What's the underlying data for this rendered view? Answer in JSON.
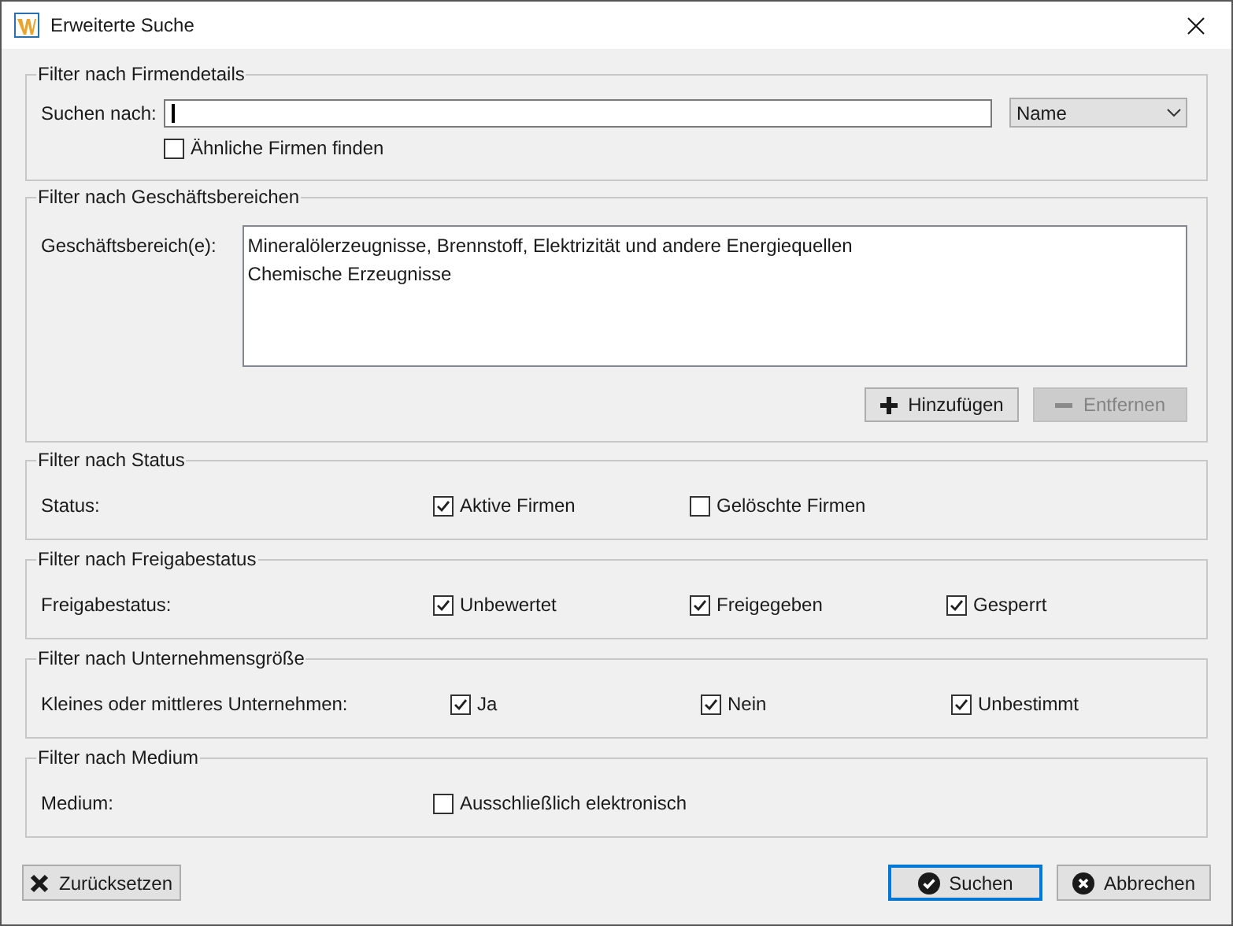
{
  "window": {
    "title": "Erweiterte Suche"
  },
  "company_details": {
    "legend": "Filter nach Firmendetails",
    "search_label": "Suchen nach:",
    "search_focused": true,
    "search_by": "Name",
    "similar": {
      "label": "Ähnliche Firmen finden",
      "checked": false
    }
  },
  "business_areas": {
    "legend": "Filter nach Geschäftsbereichen",
    "label": "Geschäftsbereich(e):",
    "items": [
      {
        "label": "Mineralölerzeugnisse, Brennstoff, Elektrizität und andere Energiequellen"
      },
      {
        "label": "Chemische Erzeugnisse"
      }
    ],
    "buttons": [
      {
        "label": "Hinzufügen",
        "kind": "plus",
        "disabled": false
      },
      {
        "label": "Entfernen",
        "kind": "minus",
        "disabled": true
      }
    ]
  },
  "filter_groups": [
    {
      "legend": "Filter nach Status",
      "label": "Status:",
      "options": [
        {
          "label": "Aktive Firmen",
          "checked": true
        },
        {
          "label": "Gelöschte Firmen",
          "checked": false
        }
      ]
    },
    {
      "legend": "Filter nach Freigabestatus",
      "label": "Freigabestatus:",
      "options": [
        {
          "label": "Unbewertet",
          "checked": true
        },
        {
          "label": "Freigegeben",
          "checked": true
        },
        {
          "label": "Gesperrt",
          "checked": true
        }
      ]
    },
    {
      "legend": "Filter nach Unternehmensgröße",
      "label": "Kleines oder mittleres Unternehmen:",
      "options": [
        {
          "label": "Ja",
          "checked": true
        },
        {
          "label": "Nein",
          "checked": true
        },
        {
          "label": "Unbestimmt",
          "checked": true
        }
      ]
    },
    {
      "legend": "Filter nach Medium",
      "label": "Medium:",
      "options": [
        {
          "label": "Ausschließlich elektronisch",
          "checked": false
        }
      ]
    }
  ],
  "footer_buttons": [
    {
      "label": "Zurücksetzen",
      "kind": "reset",
      "default": false
    },
    {
      "label": "Suchen",
      "kind": "search",
      "default": true
    },
    {
      "label": "Abbrechen",
      "kind": "cancel",
      "default": false
    }
  ]
}
